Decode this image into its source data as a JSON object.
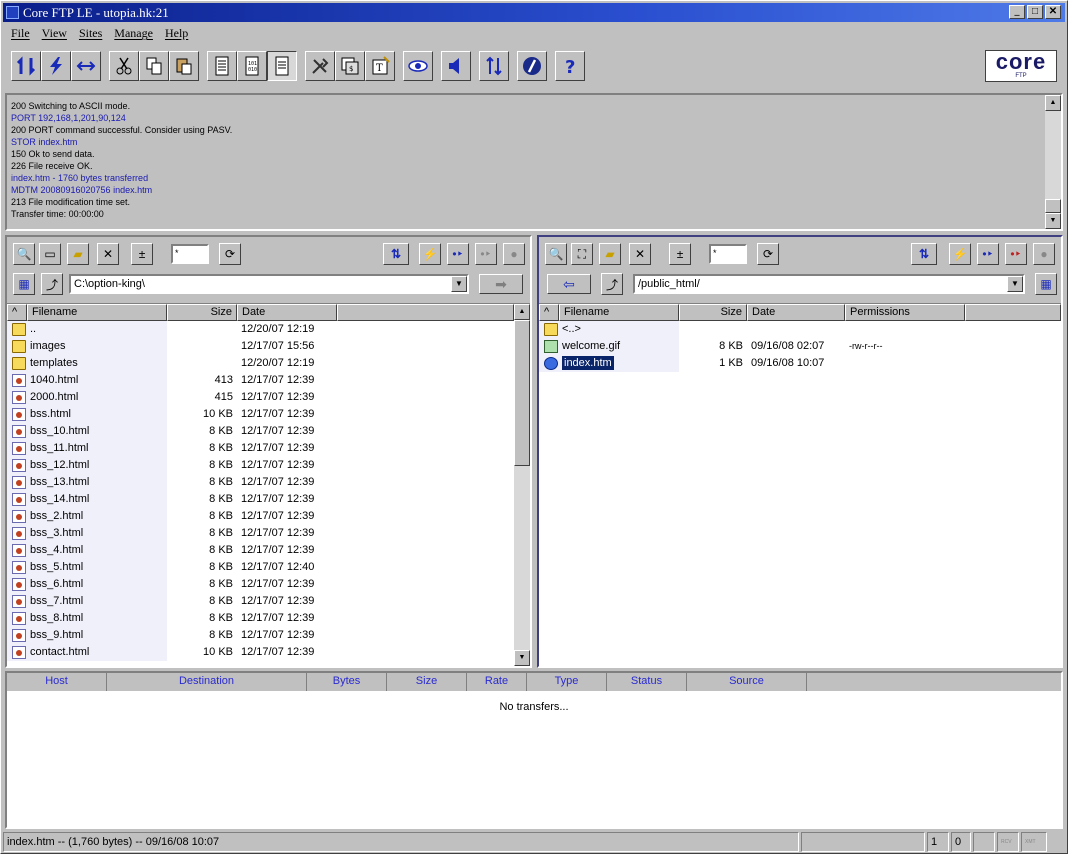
{
  "window": {
    "title": "Core FTP LE - utopia.hk:21",
    "btn_min": "_",
    "btn_max": "□",
    "btn_close": "✕"
  },
  "menu": [
    "File",
    "View",
    "Sites",
    "Manage",
    "Help"
  ],
  "logo": {
    "text": "core",
    "sub": "FTP"
  },
  "log": [
    {
      "text": "200 Switching to ASCII mode.",
      "color": "black"
    },
    {
      "text": "PORT 192,168,1,201,90,124",
      "color": "blue"
    },
    {
      "text": "200 PORT command successful. Consider using PASV.",
      "color": "black"
    },
    {
      "text": "STOR index.htm",
      "color": "blue"
    },
    {
      "text": "150 Ok to send data.",
      "color": "black"
    },
    {
      "text": "226 File receive OK.",
      "color": "black"
    },
    {
      "text": "index.htm - 1760 bytes transferred",
      "color": "blue"
    },
    {
      "text": "MDTM 20080916020756 index.htm",
      "color": "blue"
    },
    {
      "text": "213 File modification time set.",
      "color": "black"
    },
    {
      "text": "Transfer time: 00:00:00",
      "color": "black"
    }
  ],
  "local": {
    "filter": "*",
    "path": "C:\\option-king\\",
    "headers": {
      "sort": "^",
      "name": "Filename",
      "size": "Size",
      "date": "Date"
    },
    "files": [
      {
        "name": "..",
        "size": "",
        "date": "12/20/07  12:19",
        "type": "folder"
      },
      {
        "name": "images",
        "size": "",
        "date": "12/17/07  15:56",
        "type": "folder"
      },
      {
        "name": "templates",
        "size": "",
        "date": "12/20/07  12:19",
        "type": "folder"
      },
      {
        "name": "1040.html",
        "size": "413",
        "date": "12/17/07  12:39",
        "type": "doc"
      },
      {
        "name": "2000.html",
        "size": "415",
        "date": "12/17/07  12:39",
        "type": "doc"
      },
      {
        "name": "bss.html",
        "size": "10 KB",
        "date": "12/17/07  12:39",
        "type": "doc"
      },
      {
        "name": "bss_10.html",
        "size": "8 KB",
        "date": "12/17/07  12:39",
        "type": "doc"
      },
      {
        "name": "bss_11.html",
        "size": "8 KB",
        "date": "12/17/07  12:39",
        "type": "doc"
      },
      {
        "name": "bss_12.html",
        "size": "8 KB",
        "date": "12/17/07  12:39",
        "type": "doc"
      },
      {
        "name": "bss_13.html",
        "size": "8 KB",
        "date": "12/17/07  12:39",
        "type": "doc"
      },
      {
        "name": "bss_14.html",
        "size": "8 KB",
        "date": "12/17/07  12:39",
        "type": "doc"
      },
      {
        "name": "bss_2.html",
        "size": "8 KB",
        "date": "12/17/07  12:39",
        "type": "doc"
      },
      {
        "name": "bss_3.html",
        "size": "8 KB",
        "date": "12/17/07  12:39",
        "type": "doc"
      },
      {
        "name": "bss_4.html",
        "size": "8 KB",
        "date": "12/17/07  12:39",
        "type": "doc"
      },
      {
        "name": "bss_5.html",
        "size": "8 KB",
        "date": "12/17/07  12:40",
        "type": "doc"
      },
      {
        "name": "bss_6.html",
        "size": "8 KB",
        "date": "12/17/07  12:39",
        "type": "doc"
      },
      {
        "name": "bss_7.html",
        "size": "8 KB",
        "date": "12/17/07  12:39",
        "type": "doc"
      },
      {
        "name": "bss_8.html",
        "size": "8 KB",
        "date": "12/17/07  12:39",
        "type": "doc"
      },
      {
        "name": "bss_9.html",
        "size": "8 KB",
        "date": "12/17/07  12:39",
        "type": "doc"
      },
      {
        "name": "contact.html",
        "size": "10 KB",
        "date": "12/17/07  12:39",
        "type": "doc"
      }
    ]
  },
  "remote": {
    "filter": "*",
    "path": "/public_html/",
    "headers": {
      "sort": "^",
      "name": "Filename",
      "size": "Size",
      "date": "Date",
      "perms": "Permissions"
    },
    "files": [
      {
        "name": "<..>",
        "size": "",
        "date": "",
        "perms": "",
        "type": "folder",
        "selected": false
      },
      {
        "name": "welcome.gif",
        "size": "8 KB",
        "date": "09/16/08  02:07",
        "perms": "-rw-r--r--",
        "type": "gif",
        "selected": false
      },
      {
        "name": "index.htm",
        "size": "1 KB",
        "date": "09/16/08  10:07",
        "perms": "",
        "type": "ie",
        "selected": true
      }
    ]
  },
  "queue": {
    "headers": [
      "Host",
      "Destination",
      "Bytes",
      "Size",
      "Rate",
      "Type",
      "Status",
      "Source"
    ],
    "empty": "No transfers..."
  },
  "status": {
    "text": "index.htm -- (1,760 bytes) -- 09/16/08  10:07",
    "count1": "1",
    "count2": "0",
    "rcv": "RCV",
    "xmt": "XMT"
  },
  "colors": {
    "title_start": "#0a1e8a",
    "selection": "#0a246a",
    "queue_header_text": "#2a2ad0",
    "log_blue": "#1a1ab0"
  }
}
